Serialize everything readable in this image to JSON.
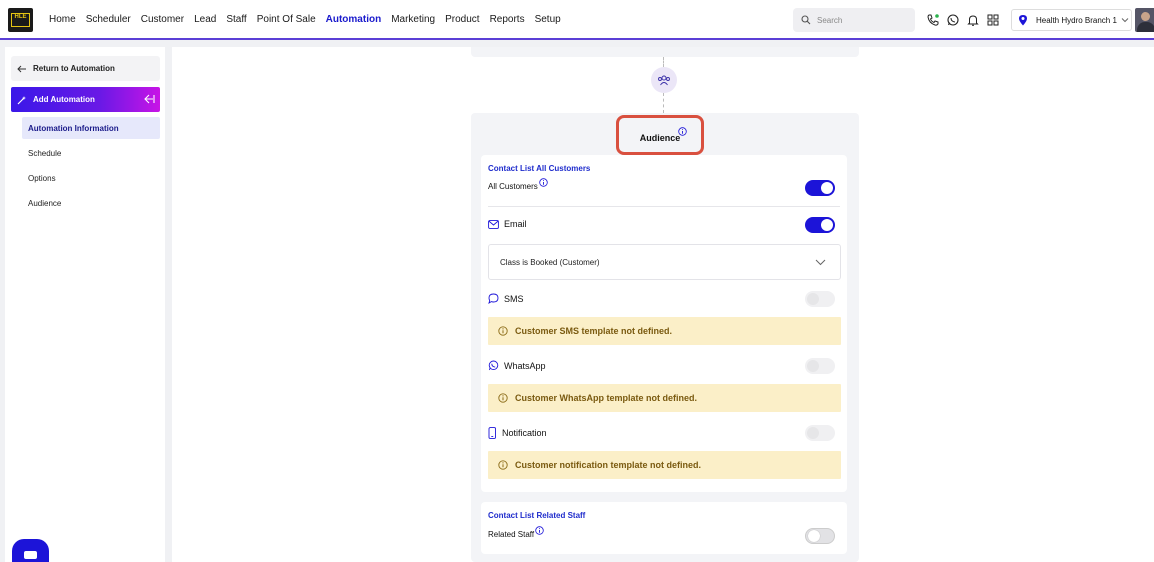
{
  "topbar": {
    "logo_text": "HLE",
    "nav": [
      "Home",
      "Scheduler",
      "Customer",
      "Lead",
      "Staff",
      "Point Of Sale",
      "Automation",
      "Marketing",
      "Product",
      "Reports",
      "Setup"
    ],
    "active_nav": "Automation",
    "search_placeholder": "Search",
    "branch": "Health Hydro Branch 1"
  },
  "sidebar": {
    "return_label": "Return to Automation",
    "add_label": "Add Automation",
    "items": [
      "Automation Information",
      "Schedule",
      "Options",
      "Audience"
    ],
    "active_item": "Automation Information"
  },
  "audience": {
    "title": "Audience",
    "customers": {
      "title": "Contact List All Customers",
      "all_label": "All Customers",
      "all_enabled": true,
      "channels": {
        "email": {
          "label": "Email",
          "enabled": true,
          "selected_template": "Class is Booked (Customer)"
        },
        "sms": {
          "label": "SMS",
          "enabled": false,
          "warning": "Customer SMS template not defined."
        },
        "whatsapp": {
          "label": "WhatsApp",
          "enabled": false,
          "warning": "Customer WhatsApp template not defined."
        },
        "notification": {
          "label": "Notification",
          "enabled": false,
          "warning": "Customer notification template not defined."
        }
      }
    },
    "staff": {
      "title": "Contact List Related Staff",
      "label": "Related Staff",
      "enabled": false
    }
  },
  "colors": {
    "accent": "#1c14d8",
    "warning_bg": "#fbefc8",
    "highlight": "#d9503f"
  }
}
